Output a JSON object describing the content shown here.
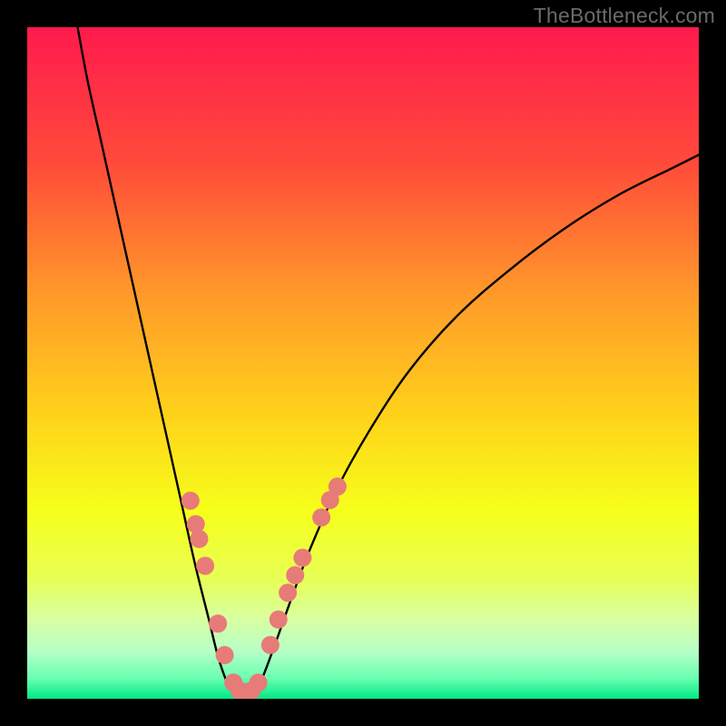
{
  "watermark": {
    "text": "TheBottleneck.com"
  },
  "chart_data": {
    "type": "line",
    "title": "",
    "xlabel": "",
    "ylabel": "",
    "xlim": [
      0,
      100
    ],
    "ylim": [
      0,
      100
    ],
    "grid": false,
    "legend": false,
    "background_gradient_stops": [
      {
        "offset": 0.0,
        "color": "#ff1a4d"
      },
      {
        "offset": 0.2,
        "color": "#ff4a3a"
      },
      {
        "offset": 0.4,
        "color": "#ff9a2a"
      },
      {
        "offset": 0.58,
        "color": "#ffd31a"
      },
      {
        "offset": 0.72,
        "color": "#f6ff1a"
      },
      {
        "offset": 0.82,
        "color": "#e8ff55"
      },
      {
        "offset": 0.88,
        "color": "#d9ffa0"
      },
      {
        "offset": 0.93,
        "color": "#b6ffc7"
      },
      {
        "offset": 0.97,
        "color": "#68ffb0"
      },
      {
        "offset": 1.0,
        "color": "#00e884"
      }
    ],
    "series": [
      {
        "name": "bottleneck-curve",
        "color": "#000000",
        "points": [
          {
            "x": 7.5,
            "y": 100.0
          },
          {
            "x": 9.0,
            "y": 92.0
          },
          {
            "x": 11.0,
            "y": 83.0
          },
          {
            "x": 13.0,
            "y": 74.0
          },
          {
            "x": 15.0,
            "y": 65.0
          },
          {
            "x": 17.0,
            "y": 56.0
          },
          {
            "x": 19.0,
            "y": 47.0
          },
          {
            "x": 21.0,
            "y": 38.0
          },
          {
            "x": 23.0,
            "y": 29.0
          },
          {
            "x": 25.0,
            "y": 20.0
          },
          {
            "x": 27.0,
            "y": 12.0
          },
          {
            "x": 28.5,
            "y": 6.0
          },
          {
            "x": 30.0,
            "y": 2.0
          },
          {
            "x": 31.5,
            "y": 0.5
          },
          {
            "x": 33.0,
            "y": 0.5
          },
          {
            "x": 34.5,
            "y": 2.0
          },
          {
            "x": 36.5,
            "y": 7.0
          },
          {
            "x": 39.0,
            "y": 14.0
          },
          {
            "x": 42.0,
            "y": 22.0
          },
          {
            "x": 46.0,
            "y": 31.0
          },
          {
            "x": 51.0,
            "y": 40.0
          },
          {
            "x": 57.0,
            "y": 49.0
          },
          {
            "x": 64.0,
            "y": 57.0
          },
          {
            "x": 72.0,
            "y": 64.0
          },
          {
            "x": 80.0,
            "y": 70.0
          },
          {
            "x": 88.0,
            "y": 75.0
          },
          {
            "x": 96.0,
            "y": 79.0
          },
          {
            "x": 100.0,
            "y": 81.0
          }
        ]
      }
    ],
    "markers": {
      "name": "highlighted-points",
      "color": "#e77b78",
      "points": [
        {
          "x": 24.3,
          "y": 29.5
        },
        {
          "x": 25.1,
          "y": 26.0
        },
        {
          "x": 25.6,
          "y": 23.8
        },
        {
          "x": 26.5,
          "y": 19.8
        },
        {
          "x": 28.4,
          "y": 11.2
        },
        {
          "x": 29.4,
          "y": 6.5
        },
        {
          "x": 30.7,
          "y": 2.4
        },
        {
          "x": 31.6,
          "y": 1.2
        },
        {
          "x": 32.4,
          "y": 1.0
        },
        {
          "x": 33.4,
          "y": 1.2
        },
        {
          "x": 34.4,
          "y": 2.4
        },
        {
          "x": 36.2,
          "y": 8.0
        },
        {
          "x": 37.4,
          "y": 11.8
        },
        {
          "x": 38.8,
          "y": 15.8
        },
        {
          "x": 39.9,
          "y": 18.4
        },
        {
          "x": 41.0,
          "y": 21.0
        },
        {
          "x": 43.8,
          "y": 27.0
        },
        {
          "x": 45.1,
          "y": 29.6
        },
        {
          "x": 46.2,
          "y": 31.6
        }
      ]
    }
  }
}
